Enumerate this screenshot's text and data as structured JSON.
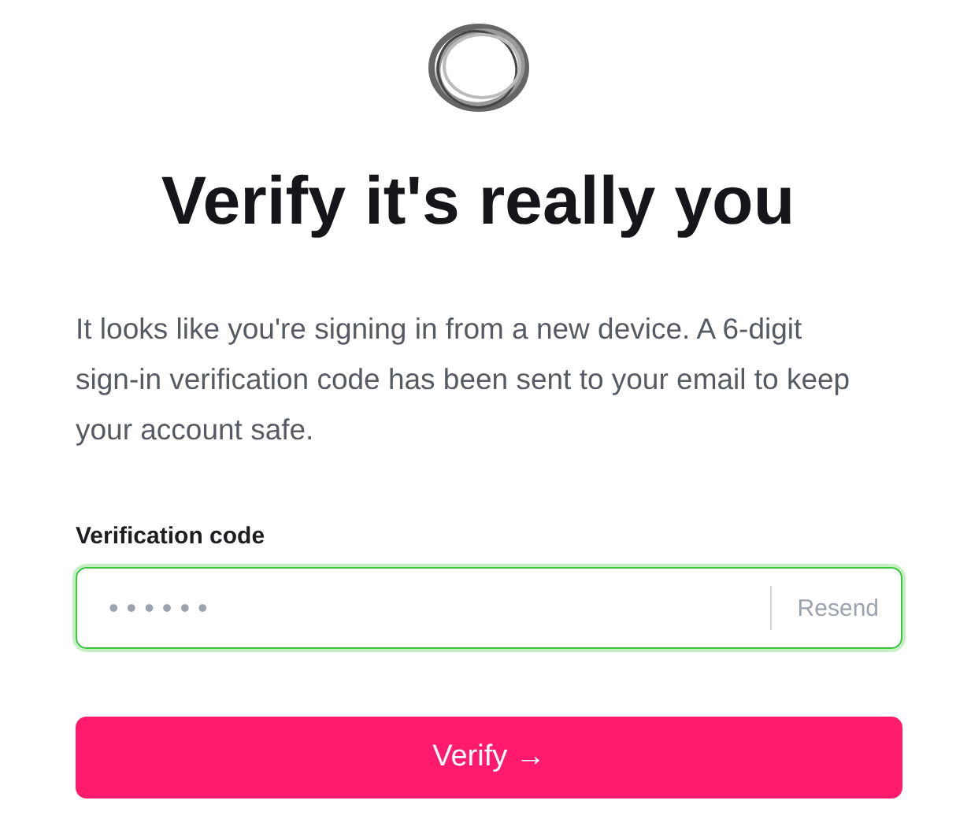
{
  "title": "Verify it's really you",
  "description": "It looks like you're signing in from a new device. A 6-digit sign-in verification code has been sent to your email to keep your account safe.",
  "code_field": {
    "label": "Verification code",
    "placeholder": "• • • • • •",
    "focused": true,
    "resend": "Resend"
  },
  "submit_button": "Verify →"
}
